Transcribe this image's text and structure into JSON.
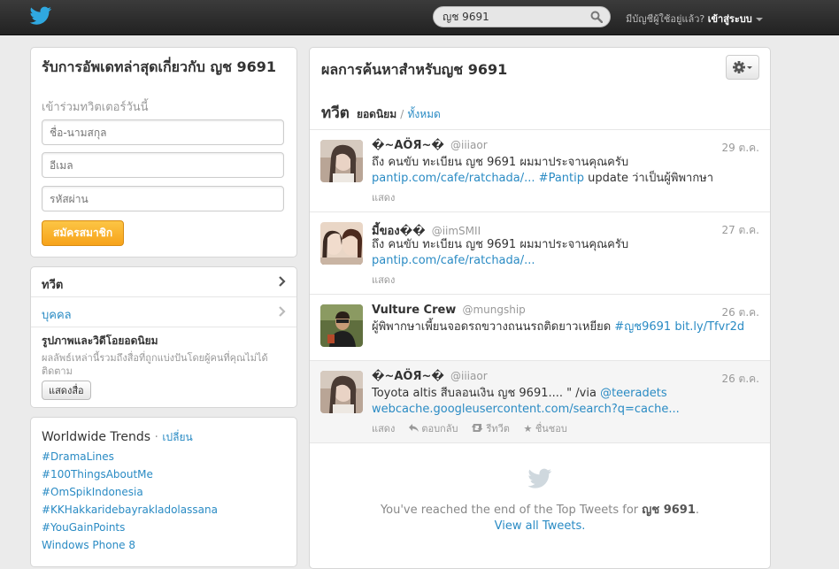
{
  "topbar": {
    "search_value": "ญช 9691",
    "signin_question": "มีบัญชีผู้ใช้อยู่แล้ว?",
    "signin_link": "เข้าสู่ระบบ"
  },
  "signup": {
    "title": "รับการอัพเดทล่าสุดเกี่ยวกับ ญช 9691",
    "subtitle": "เข้าร่วมทวิตเตอร์วันนี้",
    "name_placeholder": "ชื่อ-นามสกุล",
    "email_placeholder": "อีเมล",
    "password_placeholder": "รหัสผ่าน",
    "button": "สมัครสมาชิก"
  },
  "nav": {
    "tweets": "ทวีต",
    "people": "บุคคล",
    "photos_title": "รูปภาพและวิดีโอยอดนิยม",
    "photos_desc": "ผลลัพธ์เหล่านี้รวมถึงสื่อที่ถูกแบ่งปันโดยผู้คนที่คุณไม่ได้ติดตาม",
    "show_button": "แสดงสื่อ"
  },
  "trends": {
    "title": "Worldwide Trends",
    "change": "เปลี่ยน",
    "items": [
      "#DramaLines",
      "#100ThingsAboutMe",
      "#OmSpikIndonesia",
      "#KKHakkaridebayrakladolassana",
      "#YouGainPoints",
      "Windows Phone 8"
    ]
  },
  "main": {
    "title": "ผลการค้นหาสำหรับญช 9691",
    "tab_tweets": "ทวีต",
    "tab_top": "ยอดนิยม",
    "tab_sep": "/",
    "tab_all": "ทั้งหมด"
  },
  "tweets": [
    {
      "name": "�~AÖЯ~�",
      "handle": "@iiiaor",
      "time": "29 ต.ค.",
      "text": "ถึง คนขับ ทะเบียน ญช 9691 ผมมาประจานคุณครับ",
      "link1": "pantip.com/cafe/ratchada/...",
      "link2": "#Pantip",
      "text_tail": "update ว่าเป็นผู้พิพากษา",
      "show": "แสดง"
    },
    {
      "name": "มี้ของ��",
      "handle": "@iimSMII",
      "time": "27 ต.ค.",
      "text": "ถึง คนขับ ทะเบียน ญช 9691 ผมมาประจานคุณครับ",
      "link1": "pantip.com/cafe/ratchada/...",
      "show": "แสดง"
    },
    {
      "name": "Vulture Crew",
      "handle": "@mungship",
      "time": "26 ต.ค.",
      "text": "ผู้พิพากษาเพี้ยนจอดรถขวางถนนรถติดยาวเหยียด",
      "link1": "#ญช9691",
      "link2": "bit.ly/Tfvr2d"
    },
    {
      "name": "�~AÖЯ~�",
      "handle": "@iiiaor",
      "time": "26 ต.ค.",
      "text": "Toyota altis สีบลอนเงิน ญช 9691.... \" /via",
      "link1": "@teeradets",
      "link2": "webcache.googleusercontent.com/search?q=cache...",
      "show": "แสดง",
      "reply": "ตอบกลับ",
      "retweet": "รีทวีต",
      "favorite": "ชื่นชอบ"
    }
  ],
  "end": {
    "msg_prefix": "You've reached the end of the Top Tweets for",
    "query": "ญช 9691",
    "msg_suffix": ".",
    "view_all": "View all Tweets."
  },
  "colors": {
    "link": "#2a8bc4",
    "button_orange": "#f7a31a",
    "topbar": "#2b2b2b"
  }
}
